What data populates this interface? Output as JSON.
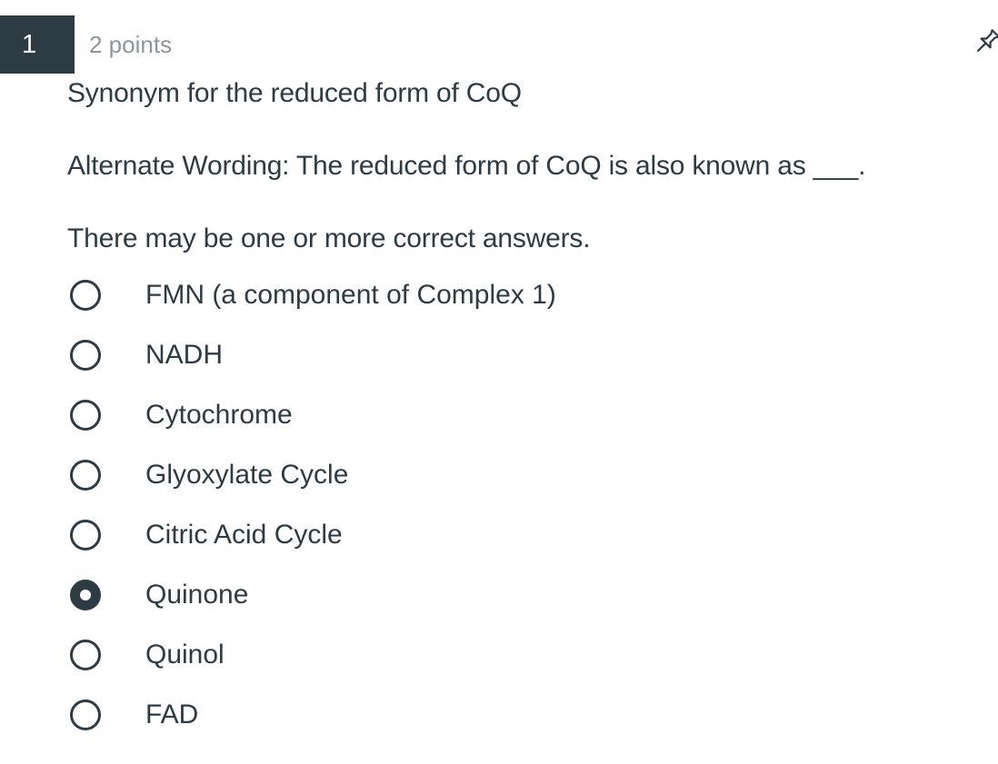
{
  "question": {
    "number": "1",
    "points": "2 points",
    "pin_icon": "pin-icon",
    "prompt": "Synonym for the reduced form of CoQ",
    "alternate": "Alternate Wording: The reduced form of CoQ is also known as ___.",
    "instructions": "There may be one or more correct answers."
  },
  "options": [
    {
      "label": "FMN (a component of Complex 1)",
      "selected": false
    },
    {
      "label": "NADH",
      "selected": false
    },
    {
      "label": "Cytochrome",
      "selected": false
    },
    {
      "label": "Glyoxylate Cycle",
      "selected": false
    },
    {
      "label": "Citric Acid Cycle",
      "selected": false
    },
    {
      "label": "Quinone",
      "selected": true
    },
    {
      "label": "Quinol",
      "selected": false
    },
    {
      "label": "FAD",
      "selected": false
    }
  ],
  "colors": {
    "accent": "#2d3b45",
    "muted_text": "#8b969e",
    "background": "#ffffff"
  }
}
